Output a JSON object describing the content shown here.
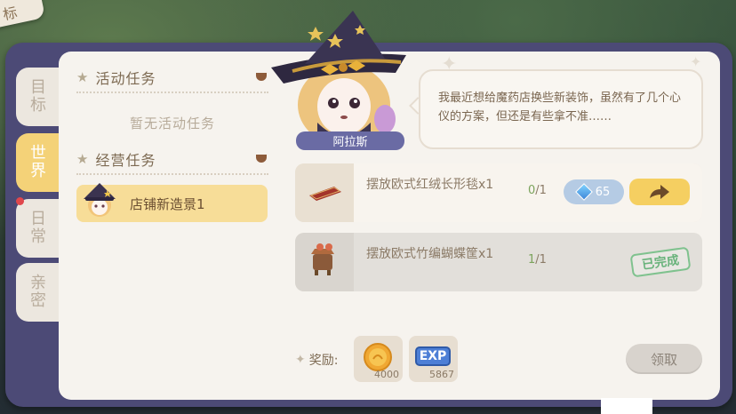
{
  "corner": {
    "label": "标"
  },
  "side_tabs": [
    {
      "label": "目标",
      "active": false
    },
    {
      "label": "世界",
      "active": true
    },
    {
      "label": "日常",
      "active": false,
      "has_alert": true
    },
    {
      "label": "亲密",
      "active": false
    }
  ],
  "activity": {
    "title": "活动任务",
    "empty_text": "暂无活动任务"
  },
  "business": {
    "title": "经营任务",
    "items": [
      {
        "label": "店铺新造景1",
        "selected": true
      }
    ]
  },
  "npc": {
    "name": "阿拉斯",
    "dialogue": "我最近想给魔药店换些新装饰，虽然有了几个心仪的方案，但还是有些拿不准……"
  },
  "requirements": [
    {
      "text": "摆放欧式红绒长形毯x1",
      "current": "0",
      "total": "/1",
      "cost": "65",
      "status": "incomplete",
      "icon": "red-rug-icon"
    },
    {
      "text": "摆放欧式竹编蝴蝶筐x1",
      "current": "1",
      "total": "/1",
      "status": "done",
      "done_label": "已完成",
      "icon": "butterfly-basket-icon"
    }
  ],
  "reward": {
    "label": "奖励:",
    "items": [
      {
        "icon": "gold-coin-icon",
        "amount": "4000"
      },
      {
        "icon": "exp-icon",
        "label": "EXP",
        "amount": "5867"
      }
    ],
    "claim_label": "领取"
  },
  "colors": {
    "frame": "#4c4a76",
    "active_tab": "#f4d278",
    "go_button": "#f5cf61",
    "done_green": "#6ab37c"
  }
}
